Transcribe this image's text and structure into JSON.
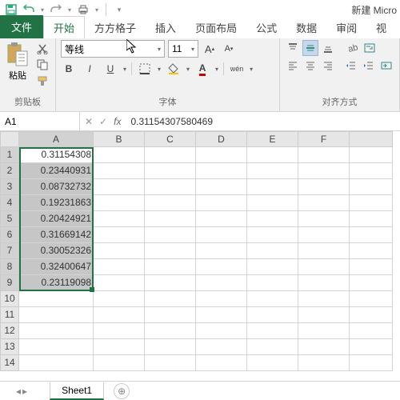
{
  "title": "新建 Micro",
  "tabs": {
    "file": "文件",
    "home": "开始",
    "fanggezi": "方方格子",
    "insert": "插入",
    "layout": "页面布局",
    "formula": "公式",
    "data": "数据",
    "review": "审阅",
    "view": "视"
  },
  "ribbon": {
    "clipboard": {
      "paste": "粘贴",
      "label": "剪贴板"
    },
    "font": {
      "name": "等线",
      "size": "11",
      "label": "字体",
      "bold": "B",
      "italic": "I",
      "underline": "U",
      "wen": "wén"
    },
    "align": {
      "label": "对齐方式"
    }
  },
  "formula_bar": {
    "name_box": "A1",
    "value": "0.31154307580469",
    "fx": "fx"
  },
  "columns": [
    "A",
    "B",
    "C",
    "D",
    "E",
    "F"
  ],
  "rows_shown": 14,
  "selected_cells": [
    "0.31154308",
    "0.23440931",
    "0.08732732",
    "0.19231863",
    "0.20424921",
    "0.31669142",
    "0.30052326",
    "0.32400647",
    "0.23119098"
  ],
  "sheet": {
    "name": "Sheet1"
  },
  "icons": {
    "dropdown": "▾",
    "plus": "⊕",
    "times": "✕",
    "check": "✓",
    "left": "◂",
    "right": "▸"
  }
}
